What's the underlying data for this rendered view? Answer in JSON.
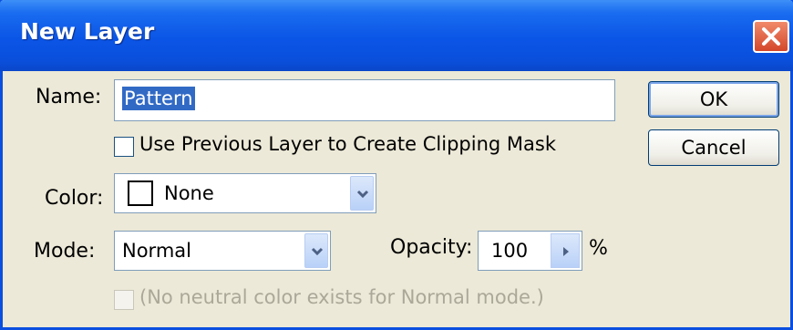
{
  "window": {
    "title": "New Layer",
    "close_icon": "close-icon"
  },
  "form": {
    "name_label": "Name:",
    "name_value": "Pattern",
    "clipping_mask_label": "Use Previous Layer to Create Clipping Mask",
    "clipping_mask_checked": false,
    "color_label": "Color:",
    "color_value": "None",
    "mode_label": "Mode:",
    "mode_value": "Normal",
    "opacity_label": "Opacity:",
    "opacity_value": "100",
    "opacity_unit": "%",
    "neutral_label": "(No neutral color exists for Normal mode.)",
    "neutral_checked": false
  },
  "buttons": {
    "ok_label": "OK",
    "cancel_label": "Cancel"
  },
  "colors": {
    "titlebar": "#0a4fdc",
    "close": "#d4472b",
    "dialog_bg": "#ece9d8",
    "selection": "#316ac5"
  }
}
